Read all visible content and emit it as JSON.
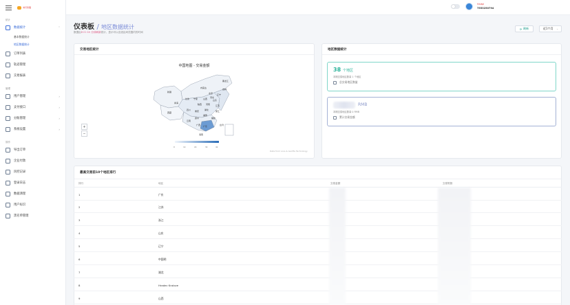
{
  "brand": {
    "logo_text": "寻行管理"
  },
  "sidebar": {
    "section1": "统计",
    "stats": {
      "label": "数据统计",
      "subs": [
        "基本数据统计",
        "地区数据统计"
      ]
    },
    "items1": [
      "订单列表",
      "轨迹管理",
      "交易报表"
    ],
    "section2": "管理",
    "items2": [
      "用户管理",
      "支付接口",
      "分账管理",
      "系统设置"
    ],
    "section3": "操作",
    "items3": [
      "导出订单",
      "企业付款",
      "风控记录",
      "登录日志",
      "数据清理",
      "用户标识",
      "黑名单管理"
    ]
  },
  "header": {
    "user_name": "hisiapi",
    "user_id": "7553250794"
  },
  "page": {
    "title": "仪表板",
    "subtitle": "地区数据统计",
    "desc_prefix": "数据由",
    "desc_highlight": "ECS GS 分钟刷新",
    "desc_suffix": "统计，显示可以自选区间范围内的时间",
    "refresh_label": "刷新",
    "range_label": "近1个月"
  },
  "map_card": {
    "title": "交易地区统计",
    "map_title": "中国地图 - 交易金额",
    "zoom_in": "+",
    "zoom_out": "−",
    "credit": "Data from Lore & Garifta Technology",
    "scale_labels": [
      "0",
      "1k",
      "2k",
      "3k",
      "4k"
    ],
    "province_labels": [
      "新疆",
      "西藏",
      "青海",
      "甘肃",
      "四川",
      "云南",
      "内蒙古",
      "黑龙江",
      "吉林",
      "辽宁",
      "北京",
      "山东",
      "江苏",
      "浙江",
      "广东",
      "广西",
      "福建",
      "湖南",
      "湖北",
      "河南",
      "陕西",
      "山西",
      "贵州",
      "海南",
      "台湾",
      "重庆",
      "河北",
      "宁夏"
    ]
  },
  "stats_card": {
    "title": "地区数据统计",
    "card1": {
      "value": "38",
      "unit": "个地区",
      "note": "本期交易地区数量 1 个地区",
      "foot": "总交易地区数量"
    },
    "card2": {
      "unit": "RMB",
      "note": "本期交易地区数量 0 RMB",
      "foot": "累计交易金额"
    }
  },
  "rank": {
    "title": "最高交易前10个地区排行",
    "headers": [
      "排行",
      "地区",
      "交易金额",
      "交易笔数"
    ],
    "rows": [
      {
        "rank": "1",
        "region": "广东"
      },
      {
        "rank": "2",
        "region": "江苏"
      },
      {
        "rank": "3",
        "region": "浙江"
      },
      {
        "rank": "4",
        "region": "山东"
      },
      {
        "rank": "5",
        "region": "辽宁"
      },
      {
        "rank": "6",
        "region": "中国明"
      },
      {
        "rank": "7",
        "region": "湖北"
      },
      {
        "rank": "8",
        "region": "Hradec Kralove"
      },
      {
        "rank": "9",
        "region": "山西"
      }
    ]
  },
  "colors": {
    "accent": "#3a6cd8",
    "teal": "#2ab39a",
    "map_dark": "#2b6db8"
  }
}
